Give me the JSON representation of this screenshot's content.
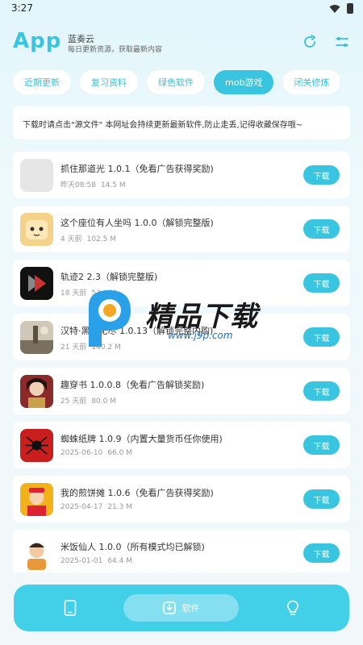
{
  "status": {
    "time": "3:27"
  },
  "header": {
    "title": "App",
    "name": "蓝奏云",
    "desc": "每日更新资源，获取最新内容"
  },
  "tabs": [
    {
      "label": "近期更新"
    },
    {
      "label": "复习资料"
    },
    {
      "label": "绿色软件"
    },
    {
      "label": "mob游戏"
    },
    {
      "label": "闭关修炼"
    }
  ],
  "notice": "下载时请点击\"源文件\"   本网址会持续更新最新软件,防止走丢,记得收藏保存哦~",
  "items": [
    {
      "name": "抓住那道光 1.0.1（免看广告获得奖励)",
      "date": "昨天08:58",
      "size": "14.5 M",
      "button": "下载"
    },
    {
      "name": "这个座位有人坐吗 1.0.0（解锁完整版)",
      "date": "4 天前",
      "size": "102.5 M",
      "button": "下载"
    },
    {
      "name": "轨迹2 2.3（解锁完整版)",
      "date": "18 天前",
      "size": "53.4 M",
      "button": "下载"
    },
    {
      "name": "汉特·黑潮无尽 1.0.13（解锁完整内购)",
      "date": "21 天前",
      "size": "140.2 M",
      "button": "下载"
    },
    {
      "name": "趣穿书 1.0.0.8（免看广告解锁奖励)",
      "date": "25 天前",
      "size": "80.0 M",
      "button": "下载"
    },
    {
      "name": "蜘蛛纸牌 1.0.9（内置大量货币任你使用)",
      "date": "2025-06-10",
      "size": "66.0 M",
      "button": "下载"
    },
    {
      "name": "我的煎饼摊 1.0.6（免看广告获得奖励)",
      "date": "2025-04-17",
      "size": "21.3 M",
      "button": "下载"
    },
    {
      "name": "米饭仙人 1.0.0（所有模式均已解锁)",
      "date": "2025-01-01",
      "size": "64.4 M",
      "button": "下载"
    }
  ],
  "watermark": {
    "text": "精品下载",
    "url": "www.j9p.com"
  },
  "bottom_nav": {
    "middle_label": "软件"
  },
  "colors": {
    "accent": "#39c5e0",
    "nav": "#42d0e8"
  }
}
